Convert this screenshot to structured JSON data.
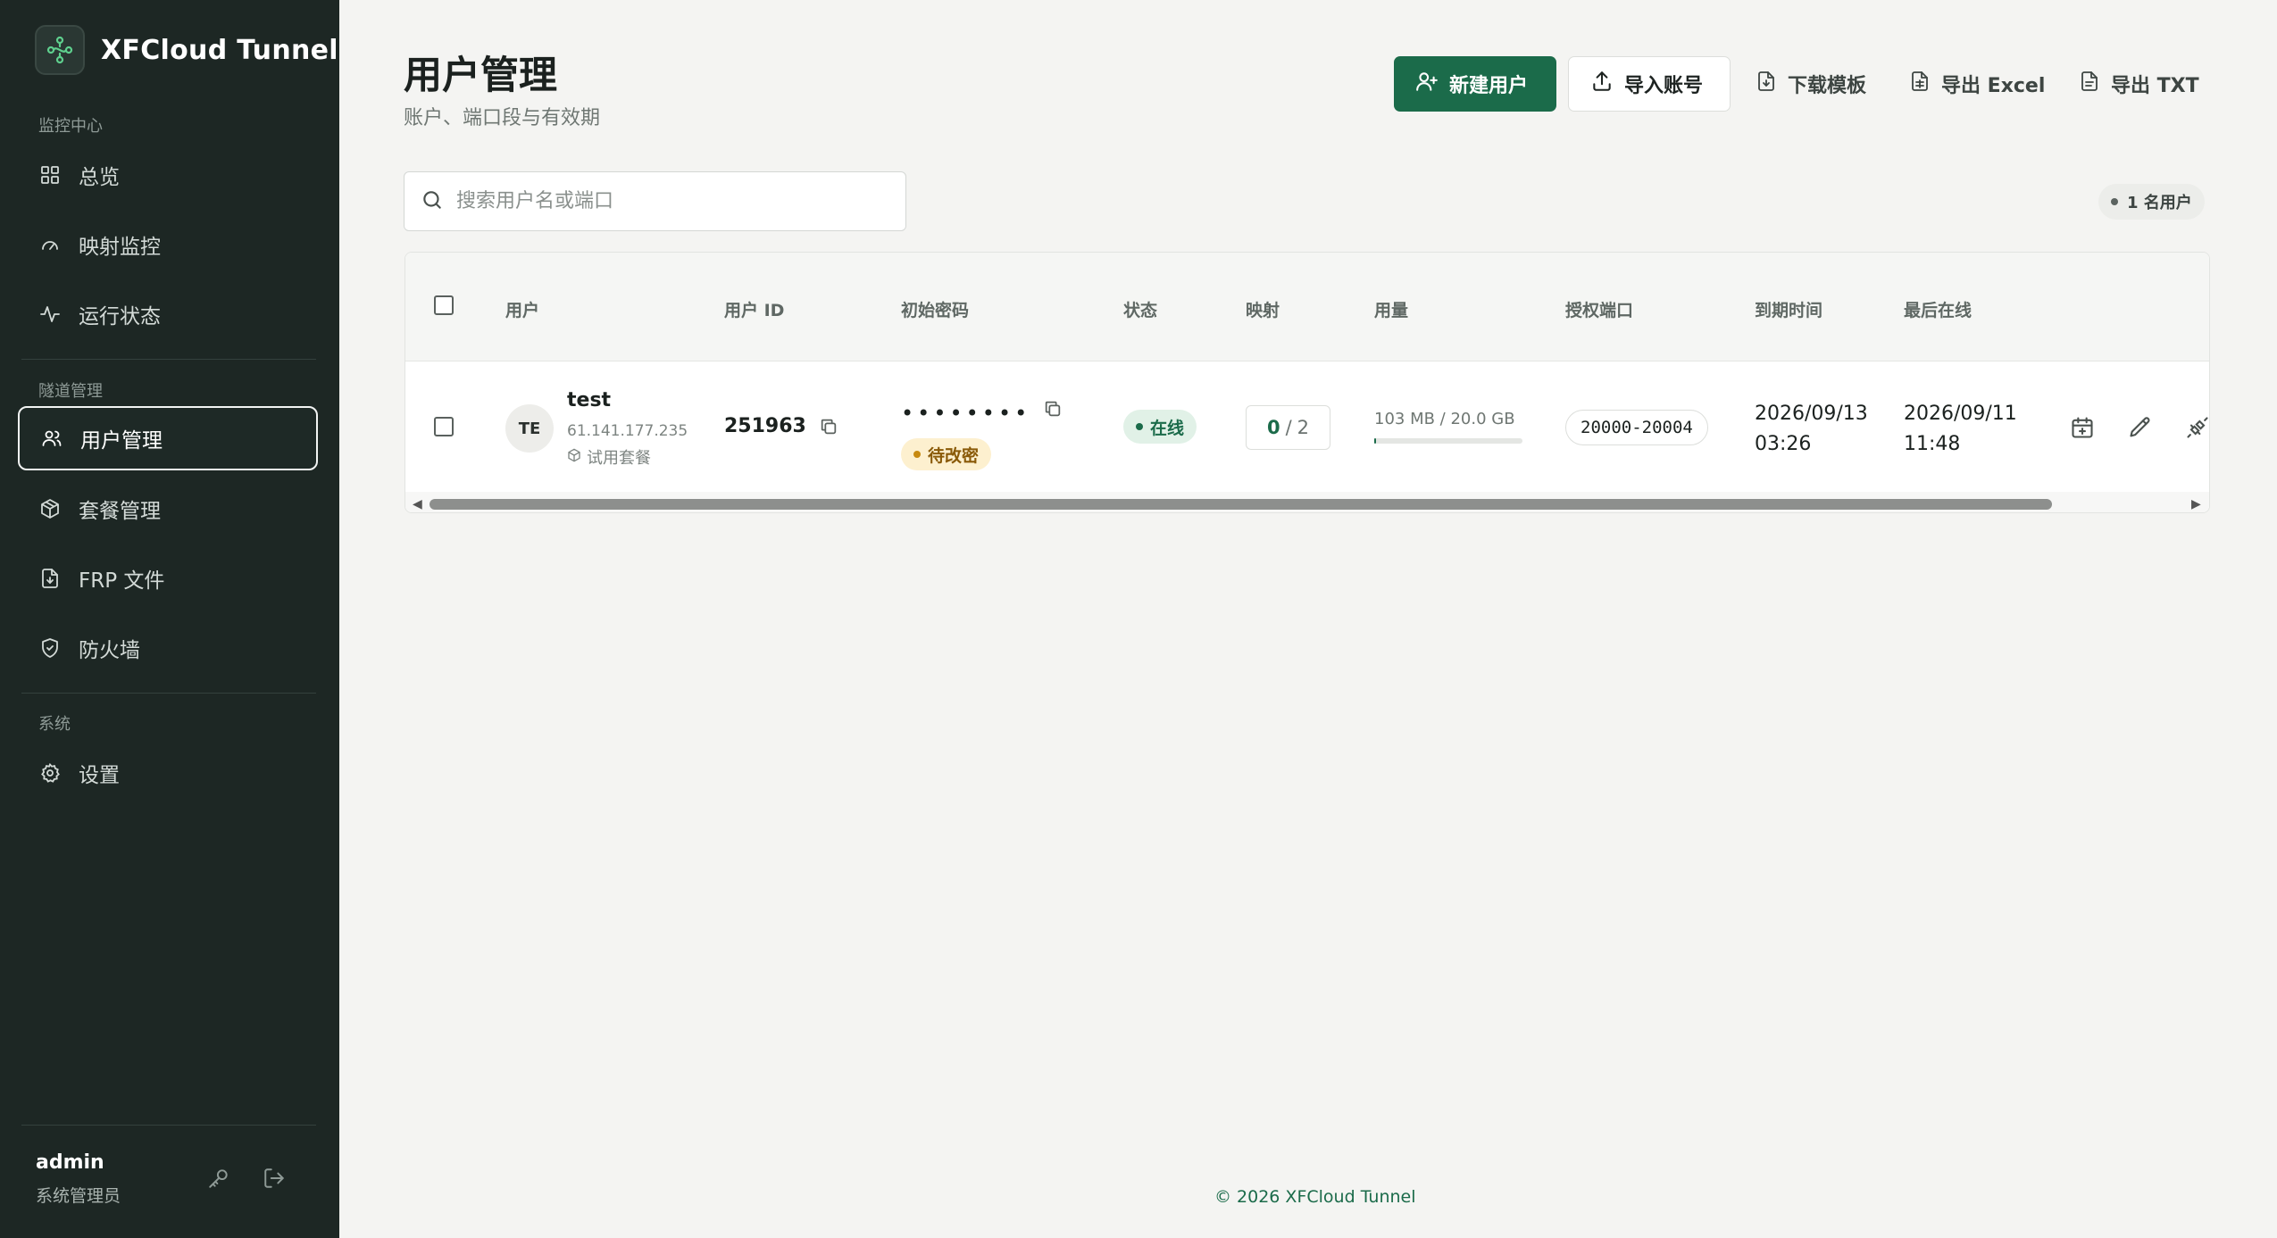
{
  "brand": {
    "name": "XFCloud Tunnel"
  },
  "sidebar": {
    "sections": [
      {
        "label": "监控中心"
      },
      {
        "label": "隧道管理"
      },
      {
        "label": "系统"
      }
    ],
    "items": [
      {
        "label": "总览",
        "icon": "grid-icon"
      },
      {
        "label": "映射监控",
        "icon": "gauge-icon"
      },
      {
        "label": "运行状态",
        "icon": "activity-icon"
      },
      {
        "label": "用户管理",
        "icon": "users-icon",
        "active": true
      },
      {
        "label": "套餐管理",
        "icon": "package-icon"
      },
      {
        "label": "FRP 文件",
        "icon": "file-download-icon"
      },
      {
        "label": "防火墙",
        "icon": "shield-icon"
      },
      {
        "label": "设置",
        "icon": "gear-icon"
      }
    ],
    "user": {
      "name": "admin",
      "role": "系统管理员"
    }
  },
  "header": {
    "title": "用户管理",
    "subtitle": "账户、端口段与有效期",
    "actions": {
      "new_user": "新建用户",
      "import": "导入账号",
      "download_template": "下载模板",
      "export_excel": "导出 Excel",
      "export_txt": "导出 TXT"
    }
  },
  "search": {
    "placeholder": "搜索用户名或端口",
    "value": ""
  },
  "user_count": "1 名用户",
  "table": {
    "columns": [
      "用户",
      "用户 ID",
      "初始密码",
      "状态",
      "映射",
      "用量",
      "授权端口",
      "到期时间",
      "最后在线"
    ],
    "rows": [
      {
        "avatar": "TE",
        "name": "test",
        "ip": "61.141.177.235",
        "plan": "试用套餐",
        "user_id": "251963",
        "password_mask": "••••••••",
        "password_badge": "待改密",
        "status": "在线",
        "mapping_used": "0",
        "mapping_sep": "/",
        "mapping_total": "2",
        "usage": "103 MB / 20.0 GB",
        "usage_fraction": 0.005,
        "ports": "20000-20004",
        "expire_date": "2026/09/13",
        "expire_time": "03:26",
        "last_online_date": "2026/09/11",
        "last_online_time": "11:48"
      }
    ]
  },
  "footer": "© 2026 XFCloud Tunnel",
  "colors": {
    "primary": "#1b6b4a",
    "sidebar_bg": "#1d2724",
    "page_bg": "#f4f4f2",
    "warning": "#c78a10"
  }
}
